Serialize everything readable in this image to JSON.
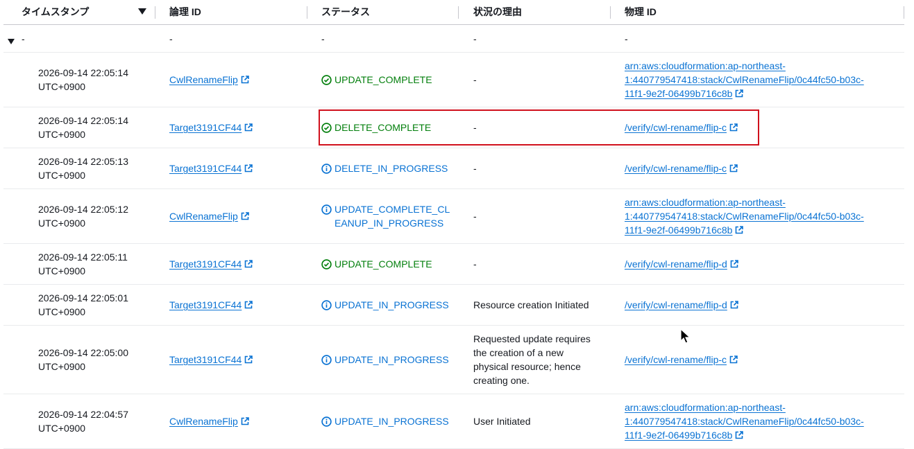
{
  "header": {
    "timestamp": "タイムスタンプ",
    "logical_id": "論理 ID",
    "status": "ステータス",
    "reason": "状況の理由",
    "physical_id": "物理 ID"
  },
  "group_row": {
    "timestamp": "-",
    "logical_id": "-",
    "status": "-",
    "reason": "-",
    "physical_id": "-"
  },
  "rows": [
    {
      "ts_date": "2026-09-14 22:05:14",
      "ts_tz": "UTC+0900",
      "logical_id": "CwlRenameFlip",
      "status": "UPDATE_COMPLETE",
      "status_lines": [
        "UPDATE_COMPLETE"
      ],
      "status_type": "success",
      "reason_lines": [
        "-"
      ],
      "physical_lines": [
        "arn:aws:cloudformation:ap-northeast-",
        "1:440779547418:stack/CwlRenameFlip/0c44fc50-b03c-",
        "11f1-9e2f-06499b716c8b"
      ]
    },
    {
      "ts_date": "2026-09-14 22:05:14",
      "ts_tz": "UTC+0900",
      "logical_id": "Target3191CF44",
      "status": "DELETE_COMPLETE",
      "status_lines": [
        "DELETE_COMPLETE"
      ],
      "status_type": "success",
      "reason_lines": [
        "-"
      ],
      "physical_lines": [
        "/verify/cwl-rename/flip-c"
      ]
    },
    {
      "ts_date": "2026-09-14 22:05:13",
      "ts_tz": "UTC+0900",
      "logical_id": "Target3191CF44",
      "status": "DELETE_IN_PROGRESS",
      "status_lines": [
        "DELETE_IN_PROGRESS"
      ],
      "status_type": "info",
      "reason_lines": [
        "-"
      ],
      "physical_lines": [
        "/verify/cwl-rename/flip-c"
      ]
    },
    {
      "ts_date": "2026-09-14 22:05:12",
      "ts_tz": "UTC+0900",
      "logical_id": "CwlRenameFlip",
      "status": "UPDATE_COMPLETE_CLEANUP_IN_PROGRESS",
      "status_lines": [
        "UPDATE_COMPLETE_CL",
        "EANUP_IN_PROGRESS"
      ],
      "status_type": "info",
      "reason_lines": [
        "-"
      ],
      "physical_lines": [
        "arn:aws:cloudformation:ap-northeast-",
        "1:440779547418:stack/CwlRenameFlip/0c44fc50-b03c-",
        "11f1-9e2f-06499b716c8b"
      ]
    },
    {
      "ts_date": "2026-09-14 22:05:11",
      "ts_tz": "UTC+0900",
      "logical_id": "Target3191CF44",
      "status": "UPDATE_COMPLETE",
      "status_lines": [
        "UPDATE_COMPLETE"
      ],
      "status_type": "success",
      "reason_lines": [
        "-"
      ],
      "physical_lines": [
        "/verify/cwl-rename/flip-d"
      ]
    },
    {
      "ts_date": "2026-09-14 22:05:01",
      "ts_tz": "UTC+0900",
      "logical_id": "Target3191CF44",
      "status": "UPDATE_IN_PROGRESS",
      "status_lines": [
        "UPDATE_IN_PROGRESS"
      ],
      "status_type": "info",
      "reason_lines": [
        "Resource creation Initiated"
      ],
      "physical_lines": [
        "/verify/cwl-rename/flip-d"
      ]
    },
    {
      "ts_date": "2026-09-14 22:05:00",
      "ts_tz": "UTC+0900",
      "logical_id": "Target3191CF44",
      "status": "UPDATE_IN_PROGRESS",
      "status_lines": [
        "UPDATE_IN_PROGRESS"
      ],
      "status_type": "info",
      "reason_lines": [
        "Requested update requires",
        "the creation of a new",
        "physical resource; hence",
        "creating one."
      ],
      "physical_lines": [
        "/verify/cwl-rename/flip-c"
      ]
    },
    {
      "ts_date": "2026-09-14 22:04:57",
      "ts_tz": "UTC+0900",
      "logical_id": "CwlRenameFlip",
      "status": "UPDATE_IN_PROGRESS",
      "status_lines": [
        "UPDATE_IN_PROGRESS"
      ],
      "status_type": "info",
      "reason_lines": [
        "User Initiated"
      ],
      "physical_lines": [
        "arn:aws:cloudformation:ap-northeast-",
        "1:440779547418:stack/CwlRenameFlip/0c44fc50-b03c-",
        "11f1-9e2f-06499b716c8b"
      ]
    }
  ],
  "highlighted_row_index": 1,
  "colors": {
    "link": "#0972d3",
    "success": "#037f0c",
    "info": "#0972d3",
    "highlight": "#d0101c"
  },
  "icons": {
    "success": "check-circle-icon",
    "info": "info-circle-icon",
    "link": "external-link-icon"
  }
}
